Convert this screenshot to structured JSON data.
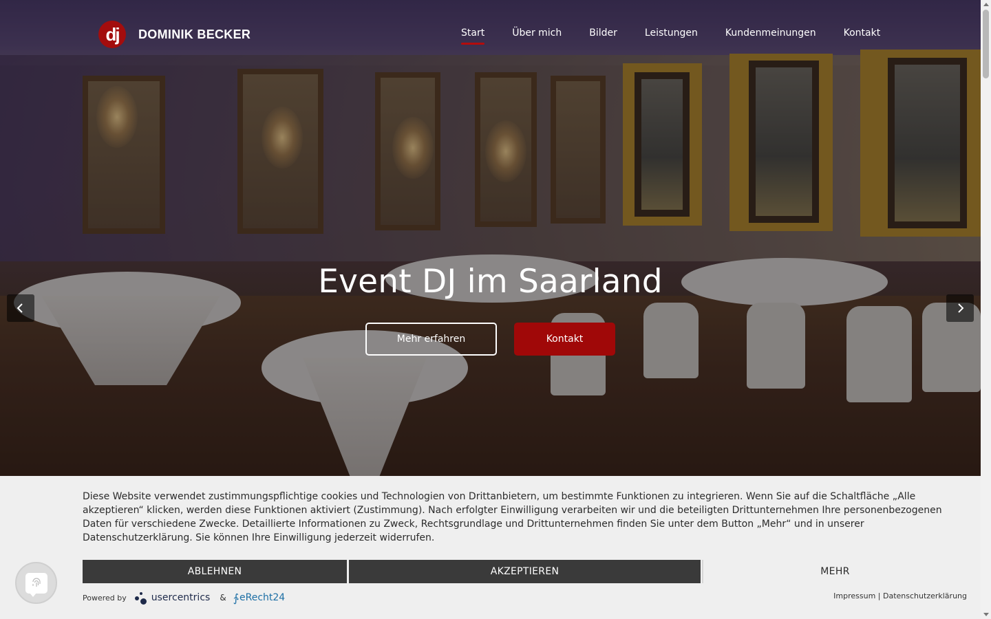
{
  "header": {
    "logo_mark": "dj",
    "brand": "DOMINIK BECKER",
    "nav": [
      {
        "label": "Start",
        "active": true
      },
      {
        "label": "Über mich",
        "active": false
      },
      {
        "label": "Bilder",
        "active": false
      },
      {
        "label": "Leistungen",
        "active": false
      },
      {
        "label": "Kundenmeinungen",
        "active": false
      },
      {
        "label": "Kontakt",
        "active": false
      }
    ]
  },
  "hero": {
    "title": "Event DJ im Saarland",
    "button_more": "Mehr erfahren",
    "button_contact": "Kontakt",
    "prev_icon": "chevron-left-icon",
    "next_icon": "chevron-right-icon"
  },
  "cookie_banner": {
    "text": "Diese Website verwendet zustimmungspflichtige cookies und Technologien von Drittanbietern, um bestimmte Funktionen zu integrieren. Wenn Sie auf die Schaltfläche „Alle akzeptieren“ klicken, werden diese Funktionen aktiviert (Zustimmung). Nach erfolgter Einwilligung verarbeiten wir und die beteiligten Drittunternehmen Ihre personenbezogenen Daten für verschiedene Zwecke. Detaillierte Informationen zu Zweck, Rechtsgrundlage und Drittunternehmen finden Sie unter dem Button „Mehr“ und in unserer Datenschutzerklärung. Sie können Ihre Einwilligung jederzeit widerrufen.",
    "reject_label": "ABLEHNEN",
    "accept_label": "AKZEPTIEREN",
    "more_label": "MEHR",
    "powered_by": "Powered by",
    "usercentrics": "usercentrics",
    "ampersand": "&",
    "erecht": "eRecht24",
    "impressum": "Impressum",
    "separator": "|",
    "datenschutz": "Datenschutzerklärung",
    "privacy_fab_icon": "fingerprint-icon"
  },
  "colors": {
    "accent_red": "#a00808",
    "nav_underline": "#b40c0c",
    "cookie_button": "#3a3a3a",
    "cookie_bg": "#efefef"
  }
}
